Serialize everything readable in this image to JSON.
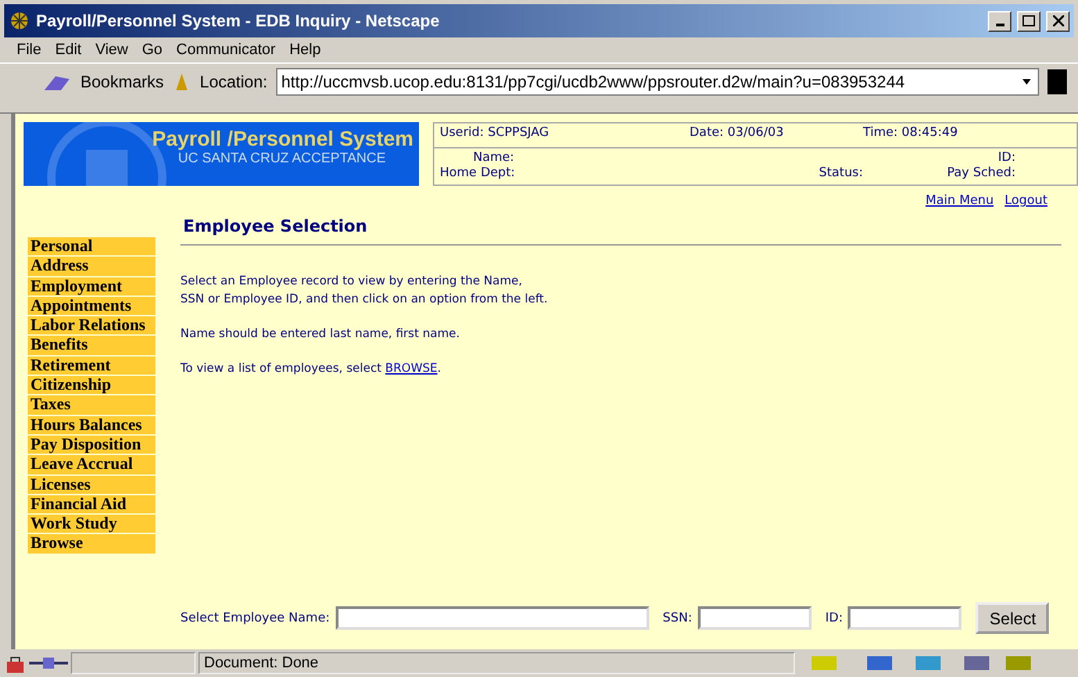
{
  "window": {
    "title": "Payroll/Personnel System - EDB Inquiry - Netscape"
  },
  "menu": [
    "File",
    "Edit",
    "View",
    "Go",
    "Communicator",
    "Help"
  ],
  "toolbar": {
    "bookmarks": "Bookmarks",
    "location_label": "Location:",
    "url": "http://uccmvsb.ucop.edu:8131/pp7cgi/ucdb2www/ppsrouter.d2w/main?u=083953244"
  },
  "banner": {
    "title": "Payroll /Personnel System",
    "subtitle": "UC SANTA CRUZ ACCEPTANCE"
  },
  "info": {
    "userid": "Userid: SCPPSJAG",
    "date": "Date: 03/06/03",
    "time": "Time: 08:45:49",
    "name": "Name:",
    "id": "ID:",
    "home_dept": "Home Dept:",
    "status": "Status:",
    "pay_sched": "Pay Sched:"
  },
  "links": [
    "Main Menu",
    "Logout"
  ],
  "sidebar": {
    "items": [
      "Personal",
      "Address",
      "Employment",
      "Appointments",
      "Labor Relations",
      "Benefits",
      "Retirement",
      "Citizenship",
      "Taxes",
      "Hours Balances",
      "Pay Disposition",
      "Leave Accrual",
      "Licenses",
      "Financial Aid",
      "Work Study",
      "Browse"
    ]
  },
  "heading": "Employee Selection",
  "paragraphs": [
    {
      "text": "Select an Employee record to view by entering the Name,\nSSN or Employee ID, and then click on an option from the left."
    },
    {
      "text": "Name should be entered last name, first name."
    },
    {
      "text": "To view a list of employees, select ",
      "link": "BROWSE",
      "after": "."
    }
  ],
  "form": {
    "name_label": "Select Employee Name:",
    "ssn_label": "SSN:",
    "id_label": "ID:",
    "button": "Select"
  },
  "status_bar": {
    "text": "Document: Done"
  }
}
